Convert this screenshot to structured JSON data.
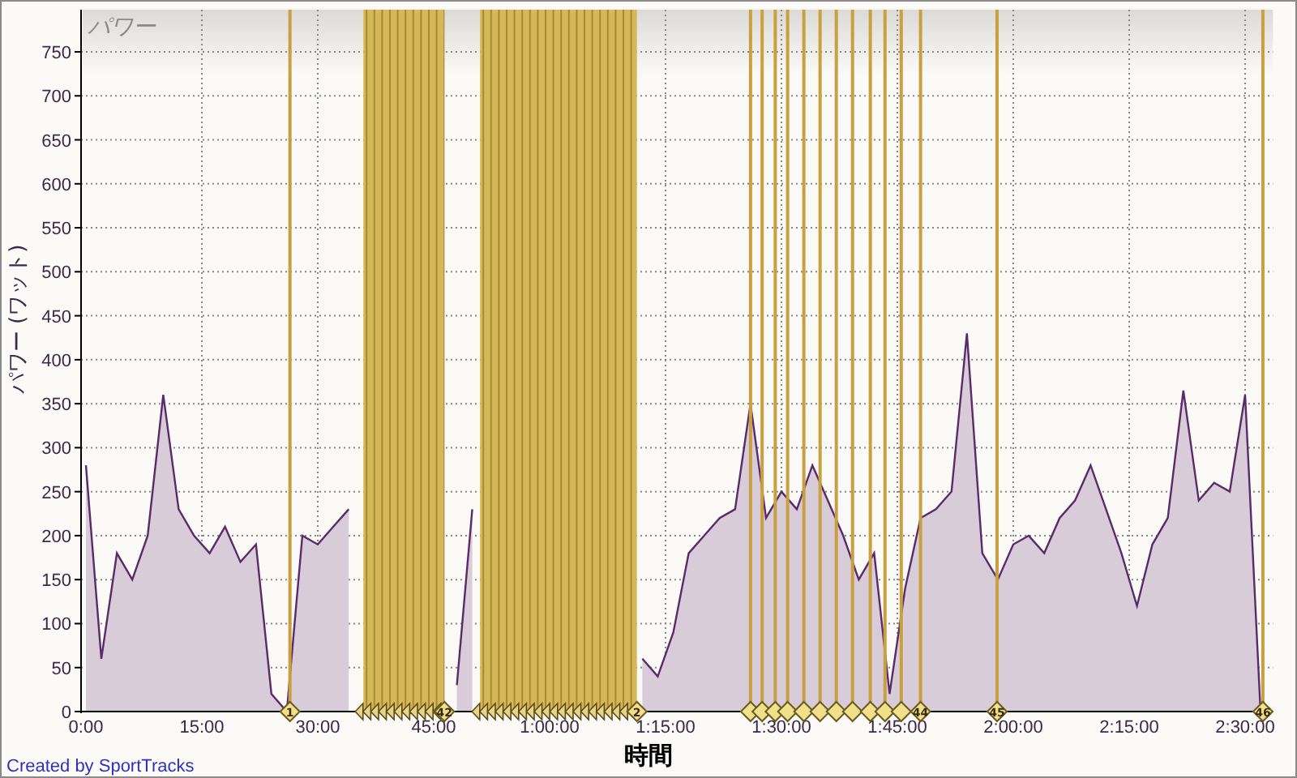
{
  "chart": {
    "chart_data": {
      "type": "area",
      "title": "パワー",
      "ylabel": "パワー (ワット)",
      "xlabel": "時間",
      "x": [
        0,
        2,
        4,
        6,
        8,
        10,
        12,
        14,
        16,
        18,
        20,
        22,
        24,
        26,
        28,
        30,
        32,
        34,
        36,
        38,
        40,
        42,
        44,
        46,
        48,
        50,
        52,
        54,
        56,
        58,
        60,
        62,
        64,
        66,
        68,
        70,
        72,
        74,
        76,
        78,
        80,
        82,
        84,
        86,
        88,
        90,
        92,
        94,
        96,
        98,
        100,
        102,
        104,
        106,
        108,
        110,
        112,
        114,
        116,
        118,
        120,
        122,
        124,
        126,
        128,
        130,
        132,
        134,
        136,
        138,
        140,
        142,
        144,
        146,
        148,
        150,
        152
      ],
      "grid": true,
      "series": [
        {
          "color": "#5a2a6a",
          "values": [
            280,
            60,
            180,
            150,
            200,
            360,
            230,
            200,
            180,
            210,
            170,
            190,
            20,
            0,
            200,
            190,
            210,
            230,
            null,
            null,
            null,
            null,
            null,
            null,
            30,
            230,
            null,
            null,
            null,
            null,
            null,
            null,
            null,
            null,
            null,
            null,
            60,
            40,
            90,
            180,
            200,
            220,
            230,
            350,
            220,
            250,
            230,
            280,
            240,
            200,
            150,
            180,
            20,
            140,
            220,
            230,
            250,
            430,
            180,
            150,
            190,
            200,
            180,
            220,
            240,
            280,
            230,
            180,
            120,
            190,
            220,
            365,
            240,
            260,
            250,
            360,
            0
          ]
        }
      ],
      "xlim": [
        0,
        153.6
      ],
      "ylim": [
        0,
        798
      ],
      "xticks": [
        {
          "value": 0,
          "label": "0:00"
        },
        {
          "value": 15,
          "label": "15:00"
        },
        {
          "value": 30,
          "label": "30:00"
        },
        {
          "value": 45,
          "label": "45:00"
        },
        {
          "value": 60,
          "label": "1:00:00"
        },
        {
          "value": 75,
          "label": "1:15:00"
        },
        {
          "value": 90,
          "label": "1:30:00"
        },
        {
          "value": 105,
          "label": "1:45:00"
        },
        {
          "value": 120,
          "label": "2:00:00"
        },
        {
          "value": 135,
          "label": "2:15:00"
        },
        {
          "value": 150,
          "label": "2:30:00"
        }
      ],
      "yticks": [
        0,
        50,
        100,
        150,
        200,
        250,
        300,
        350,
        400,
        450,
        500,
        550,
        600,
        650,
        700,
        750
      ],
      "bands": [
        {
          "axis": "x",
          "from": 35.9,
          "to": 46.4
        },
        {
          "axis": "x",
          "from": 51.0,
          "to": 71.3
        }
      ],
      "annotations": [
        {
          "x": 26.4,
          "y": 0,
          "text": "1"
        },
        {
          "x": 46.4,
          "y": 0,
          "text": "42"
        },
        {
          "x": 71.3,
          "y": 0,
          "text": "2"
        },
        {
          "x": 108.0,
          "y": 0,
          "text": "44"
        },
        {
          "x": 117.9,
          "y": 0,
          "text": "45"
        },
        {
          "x": 152.3,
          "y": 0,
          "text": "46"
        }
      ],
      "ref_lines": [
        {
          "axis": "x",
          "value": 26.4
        },
        {
          "axis": "x",
          "value": 86.0
        },
        {
          "axis": "x",
          "value": 87.5
        },
        {
          "axis": "x",
          "value": 89.2
        },
        {
          "axis": "x",
          "value": 90.8
        },
        {
          "axis": "x",
          "value": 92.9
        },
        {
          "axis": "x",
          "value": 95.0
        },
        {
          "axis": "x",
          "value": 97.1
        },
        {
          "axis": "x",
          "value": 99.2
        },
        {
          "axis": "x",
          "value": 101.5
        },
        {
          "axis": "x",
          "value": 103.4
        },
        {
          "axis": "x",
          "value": 105.5
        },
        {
          "axis": "x",
          "value": 108.0
        },
        {
          "axis": "x",
          "value": 117.9
        },
        {
          "axis": "x",
          "value": 152.3
        }
      ]
    }
  },
  "credit": "Created by SportTracks"
}
